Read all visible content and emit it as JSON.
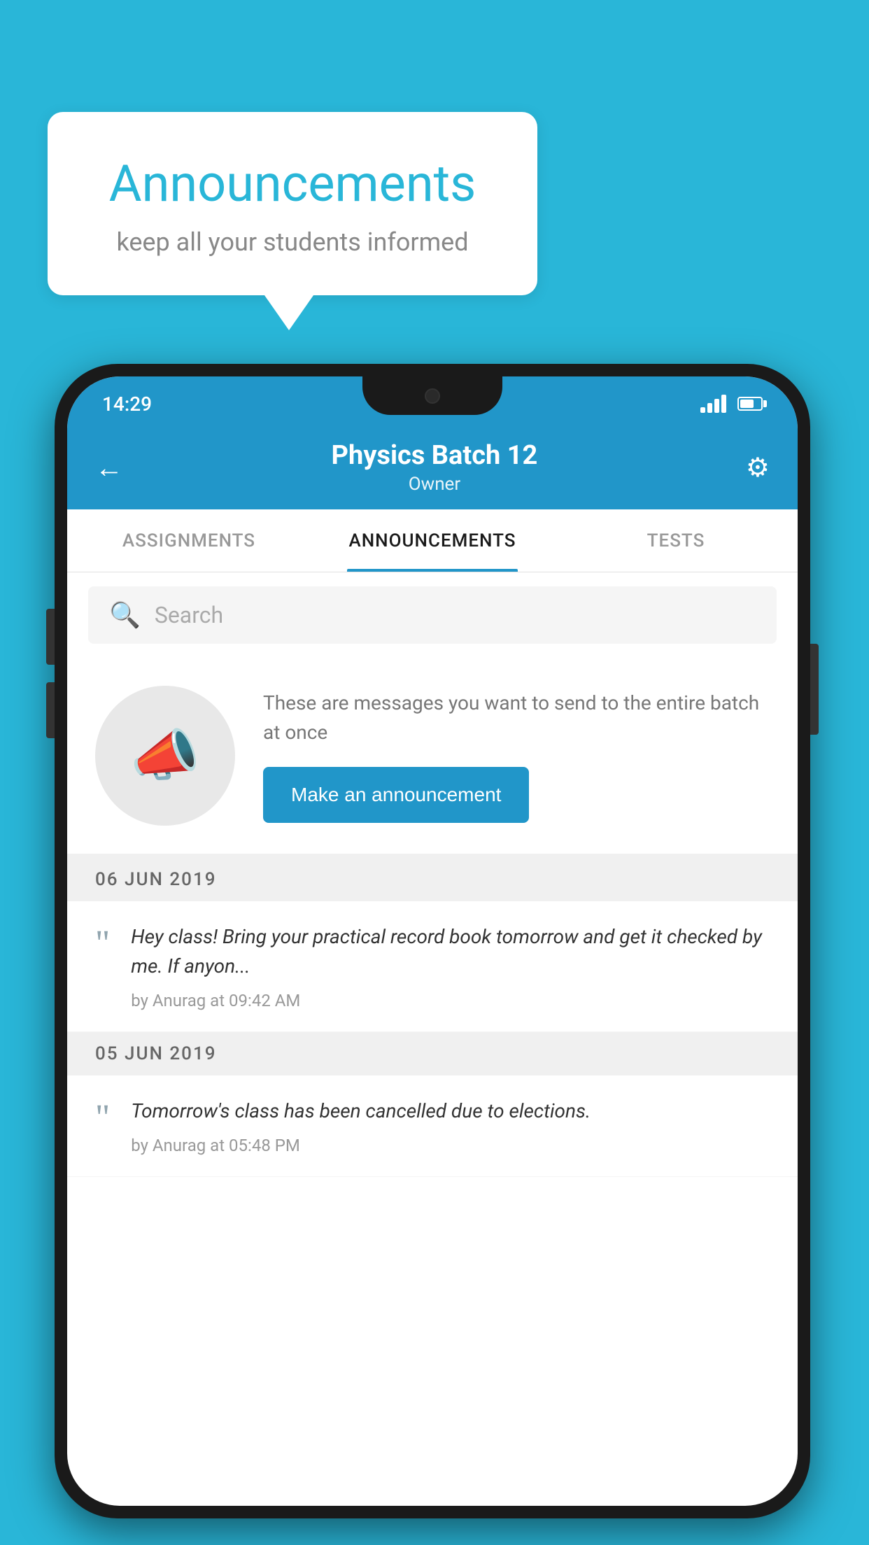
{
  "background_color": "#29b6d8",
  "speech_bubble": {
    "title": "Announcements",
    "subtitle": "keep all your students informed"
  },
  "phone": {
    "status_bar": {
      "time": "14:29"
    },
    "header": {
      "title": "Physics Batch 12",
      "subtitle": "Owner",
      "back_label": "←",
      "gear_label": "⚙"
    },
    "tabs": [
      {
        "label": "ASSIGNMENTS",
        "active": false
      },
      {
        "label": "ANNOUNCEMENTS",
        "active": true
      },
      {
        "label": "TESTS",
        "active": false
      }
    ],
    "search": {
      "placeholder": "Search"
    },
    "announcement_intro": {
      "description": "These are messages you want to send to the entire batch at once",
      "button_label": "Make an announcement"
    },
    "announcement_groups": [
      {
        "date": "06  JUN  2019",
        "items": [
          {
            "text": "Hey class! Bring your practical record book tomorrow and get it checked by me. If anyon...",
            "meta": "by Anurag at 09:42 AM"
          }
        ]
      },
      {
        "date": "05  JUN  2019",
        "items": [
          {
            "text": "Tomorrow's class has been cancelled due to elections.",
            "meta": "by Anurag at 05:48 PM"
          }
        ]
      }
    ]
  }
}
